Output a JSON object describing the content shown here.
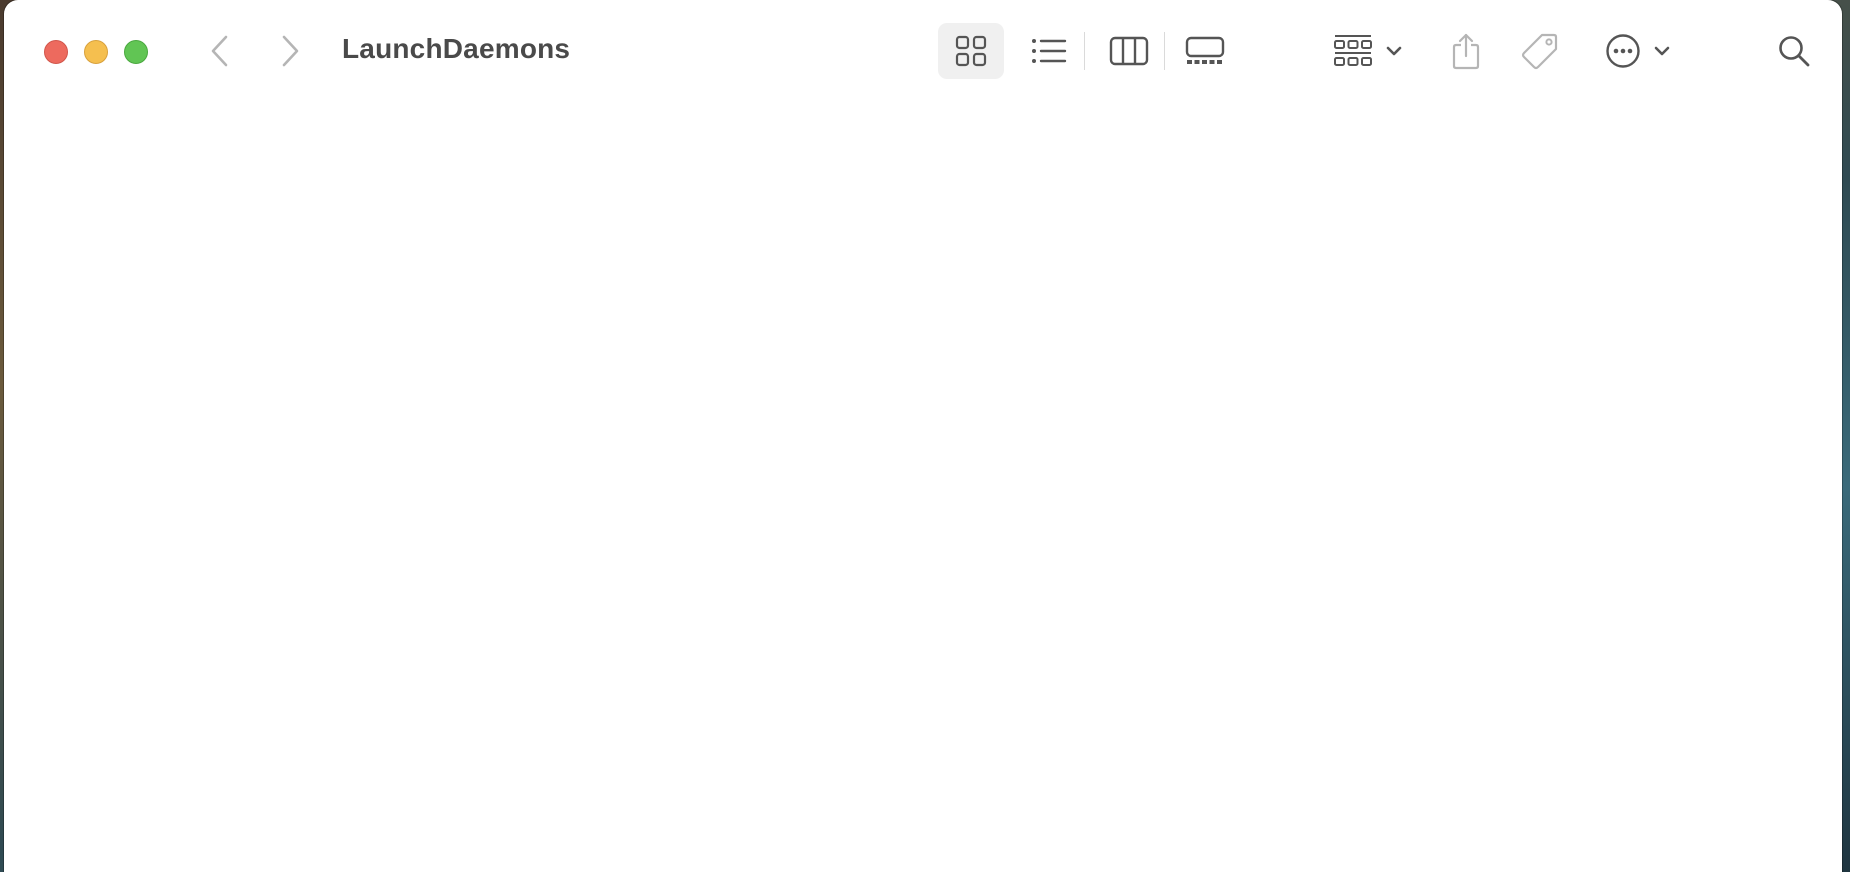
{
  "window": {
    "title": "LaunchDaemons"
  },
  "toolbar": {
    "traffic_lights": [
      "close",
      "minimize",
      "zoom"
    ],
    "navigation": [
      {
        "name": "back",
        "icon": "chevron-left-icon",
        "enabled": false
      },
      {
        "name": "forward",
        "icon": "chevron-right-icon",
        "enabled": false
      }
    ],
    "view_modes": [
      {
        "name": "icons",
        "icon": "grid-icon",
        "selected": true
      },
      {
        "name": "list",
        "icon": "list-icon",
        "selected": false
      },
      {
        "name": "columns",
        "icon": "columns-icon",
        "selected": false
      },
      {
        "name": "gallery",
        "icon": "gallery-icon",
        "selected": false
      }
    ],
    "actions": [
      {
        "name": "group",
        "icon": "group-icon",
        "has_dropdown": true
      },
      {
        "name": "share",
        "icon": "share-icon",
        "enabled": false
      },
      {
        "name": "tags",
        "icon": "tag-icon",
        "enabled": false
      },
      {
        "name": "more",
        "icon": "ellipsis-circle-icon",
        "has_dropdown": true
      },
      {
        "name": "search",
        "icon": "search-icon"
      }
    ]
  },
  "colors": {
    "close": "#ed6a5e",
    "minimize": "#f5bf4f",
    "zoom": "#61c554",
    "title_text": "#4a4a4a",
    "icon_active": "#555555",
    "icon_disabled": "#b5b5b5",
    "selected_bg": "#f0f0f0"
  }
}
